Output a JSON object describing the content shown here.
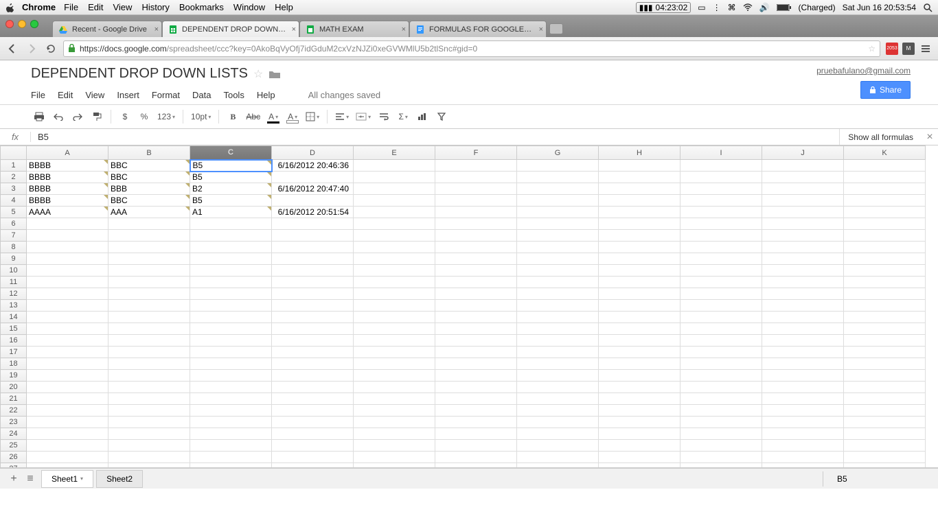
{
  "mac_menu": {
    "app": "Chrome",
    "items": [
      "File",
      "Edit",
      "View",
      "History",
      "Bookmarks",
      "Window",
      "Help"
    ],
    "timer": "04:23:02",
    "battery": "(Charged)",
    "clock": "Sat Jun 16  20:53:54"
  },
  "chrome": {
    "tabs": [
      {
        "title": "Recent - Google Drive"
      },
      {
        "title": "DEPENDENT DROP DOWN LIS"
      },
      {
        "title": "MATH EXAM"
      },
      {
        "title": "FORMULAS FOR GOOGLE SPR"
      }
    ],
    "url_host": "https://docs.google.com",
    "url_path": "/spreadsheet/ccc?key=0AkoBqVyOfj7idGduM2cxVzNJZi0xeGVWMlU5b2tlSnc#gid=0",
    "ext_cal": "2053",
    "ext_m": "M"
  },
  "sheets": {
    "title": "DEPENDENT DROP DOWN LISTS",
    "user": "pruebafulano@gmail.com",
    "share": "Share",
    "menus": [
      "File",
      "Edit",
      "View",
      "Insert",
      "Format",
      "Data",
      "Tools",
      "Help"
    ],
    "status": "All changes saved",
    "fontsize": "10pt",
    "formula_value": "B5",
    "show_all": "Show all formulas",
    "columns": [
      "A",
      "B",
      "C",
      "D",
      "E",
      "F",
      "G",
      "H",
      "I",
      "J",
      "K"
    ],
    "active_col": "C",
    "active_cell": "C1",
    "row_count": 27,
    "rows": {
      "1": {
        "A": "BBBB",
        "B": "BBC",
        "C": "B5",
        "D": "6/16/2012 20:46:36"
      },
      "2": {
        "A": "BBBB",
        "B": "BBC",
        "C": "B5"
      },
      "3": {
        "A": "BBBB",
        "B": "BBB",
        "C": "B2",
        "D": "6/16/2012 20:47:40"
      },
      "4": {
        "A": "BBBB",
        "B": "BBC",
        "C": "B5"
      },
      "5": {
        "A": "AAAA",
        "B": "AAA",
        "C": "A1",
        "D": "6/16/2012 20:51:54"
      }
    },
    "sheet_tabs": [
      "Sheet1",
      "Sheet2"
    ],
    "status_right": "B5"
  }
}
